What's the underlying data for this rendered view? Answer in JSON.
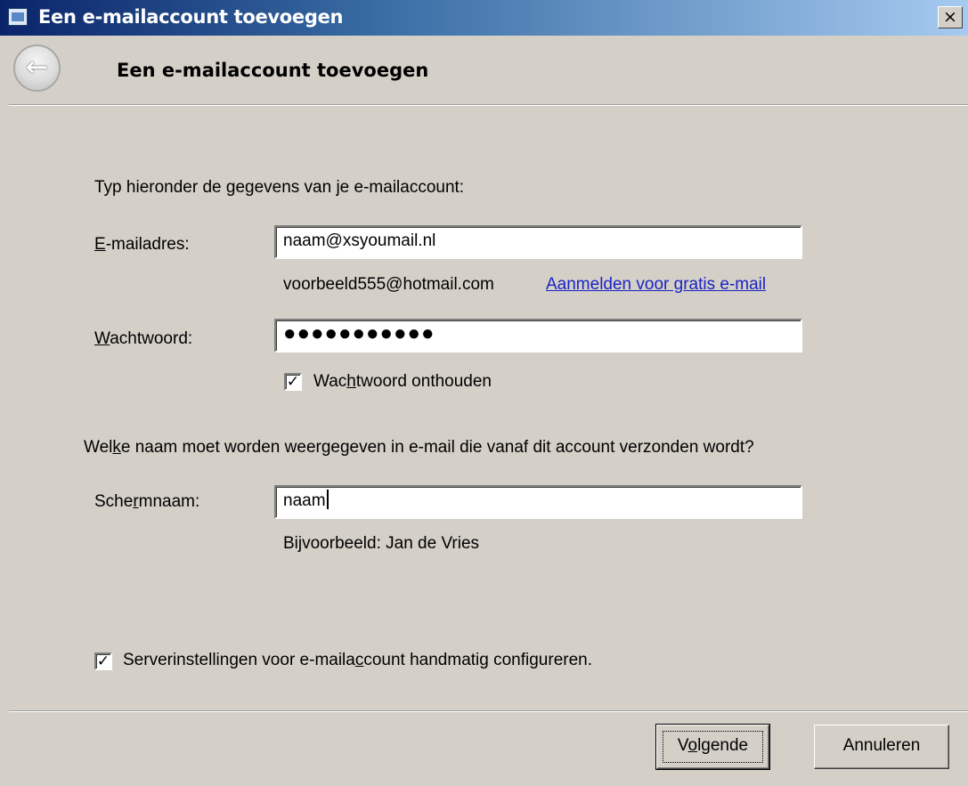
{
  "window": {
    "title": "Een e-mailaccount toevoegen",
    "close_glyph": "×"
  },
  "header": {
    "back_glyph": "←",
    "heading": "Een e-mailaccount toevoegen"
  },
  "form": {
    "intro": "Typ hieronder de gegevens van je e-mailaccount:",
    "email": {
      "label_accel": "E",
      "label_rest": "-mailadres:",
      "value": "naam@xsyoumail.nl",
      "example": "voorbeeld555@hotmail.com",
      "signup_link": "Aanmelden voor gratis e-mail"
    },
    "password": {
      "label_accel": "W",
      "label_rest": "achtwoord:",
      "masked_value": "●●●●●●●●●●●"
    },
    "remember": {
      "checked": true,
      "check_glyph": "✓",
      "label_pre": "Wac",
      "label_accel": "h",
      "label_post": "twoord onthouden"
    },
    "display_question": {
      "pre": "Wel",
      "accel": "k",
      "post": "e naam moet worden weergegeven in e-mail die vanaf dit account verzonden wordt?"
    },
    "display_name": {
      "label_pre": "Sche",
      "label_accel": "r",
      "label_post": "mnaam:",
      "value": "naam",
      "example": "Bijvoorbeeld: Jan de Vries"
    },
    "manual_config": {
      "checked": true,
      "check_glyph": "✓",
      "label_pre": "Serverinstellingen voor e-maila",
      "label_accel": "c",
      "label_post": "count handmatig configureren."
    }
  },
  "buttons": {
    "next_pre": "V",
    "next_accel": "o",
    "next_post": "lgende",
    "cancel": "Annuleren"
  }
}
